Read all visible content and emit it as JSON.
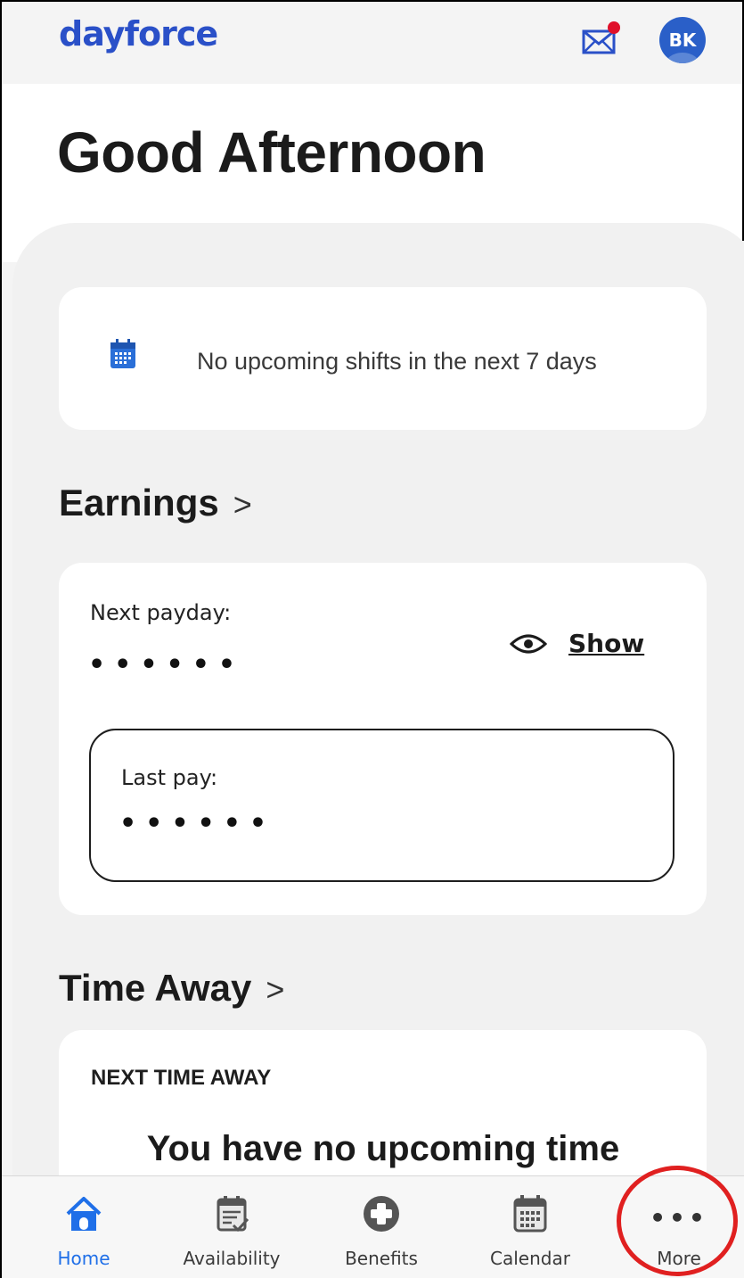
{
  "header": {
    "logo": "dayforce",
    "avatar_initials": "BK",
    "mail_icon": "mail-icon",
    "notification_dot_color": "#e0102a"
  },
  "greeting": "Good Afternoon",
  "shifts": {
    "icon": "calendar-icon",
    "message": "No upcoming shifts in the next 7 days"
  },
  "earnings": {
    "title": "Earnings",
    "chevron": ">",
    "next_payday_label": "Next payday:",
    "next_payday_value": "••••••",
    "show_label": "Show",
    "last_pay_label": "Last pay:",
    "last_pay_value": "••••••"
  },
  "time_away": {
    "title": "Time Away",
    "chevron": ">",
    "next_label": "NEXT TIME AWAY",
    "message": "You have no upcoming time"
  },
  "tabbar": {
    "tabs": [
      {
        "label": "Home",
        "icon": "home-icon",
        "active": true
      },
      {
        "label": "Availability",
        "icon": "availability-icon",
        "active": false
      },
      {
        "label": "Benefits",
        "icon": "benefits-icon",
        "active": false
      },
      {
        "label": "Calendar",
        "icon": "calendar-icon",
        "active": false
      },
      {
        "label": "More",
        "icon": "more-icon",
        "active": false
      }
    ]
  },
  "colors": {
    "brand": "#2a50c8",
    "active_tab": "#1f6fe8",
    "annotation": "#e02020"
  }
}
